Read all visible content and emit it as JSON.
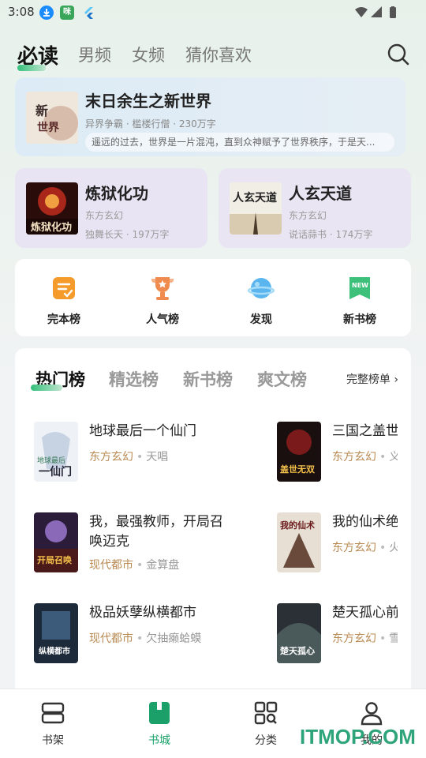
{
  "status_bar": {
    "time": "3:08",
    "app_badge": "咪"
  },
  "top_tabs": [
    {
      "label": "必读",
      "active": true
    },
    {
      "label": "男频",
      "active": false
    },
    {
      "label": "女频",
      "active": false
    },
    {
      "label": "猜你喜欢",
      "active": false
    }
  ],
  "featured": {
    "title": "末日余生之新世界",
    "meta": "异界争霸 · 槛楼行僧 · 230万字",
    "desc": "遥远的过去，世界是一片混沌，直到众神赋予了世界秩序，于是天...",
    "cover_text": "新世界"
  },
  "mini_cards": [
    {
      "title": "炼狱化功",
      "category": "东方玄幻",
      "meta": "独舞长天 · 197万字",
      "cover_text": "炼狱化功"
    },
    {
      "title": "人玄天道",
      "category": "东方玄幻",
      "meta": "说话蒜书 · 174万字",
      "cover_text": "人玄天道"
    }
  ],
  "shortcuts": [
    {
      "label": "完本榜",
      "icon": "checklist-icon",
      "color": "#f59b2b"
    },
    {
      "label": "人气榜",
      "icon": "trophy-icon",
      "color": "#f08b4f"
    },
    {
      "label": "发现",
      "icon": "planet-icon",
      "color": "#5bb6f0"
    },
    {
      "label": "新书榜",
      "icon": "new-badge-icon",
      "color": "#3dc07a"
    }
  ],
  "rank": {
    "tabs": [
      {
        "label": "热门榜",
        "active": true
      },
      {
        "label": "精选榜",
        "active": false
      },
      {
        "label": "新书榜",
        "active": false
      },
      {
        "label": "爽文榜",
        "active": false
      }
    ],
    "full_list_label": "完整榜单",
    "books": [
      {
        "title": "地球最后一个仙门",
        "category": "东方玄幻",
        "author": "天唱"
      },
      {
        "title": "三国之盖世",
        "category": "东方玄幻",
        "author": "义"
      },
      {
        "title": "我，最强教师，开局召唤迈克",
        "category": "现代都市",
        "author": "金算盘"
      },
      {
        "title": "我的仙术绝",
        "category": "东方玄幻",
        "author": "火"
      },
      {
        "title": "极品妖孽纵横都市",
        "category": "现代都市",
        "author": "欠抽癞蛤蟆"
      },
      {
        "title": "楚天孤心前",
        "category": "东方玄幻",
        "author": "雪"
      }
    ]
  },
  "bottom_nav": [
    {
      "label": "书架",
      "icon": "bookshelf-icon",
      "active": false
    },
    {
      "label": "书城",
      "icon": "bookstore-icon",
      "active": true
    },
    {
      "label": "分类",
      "icon": "category-icon",
      "active": false
    },
    {
      "label": "我的",
      "icon": "profile-icon",
      "active": false
    }
  ],
  "watermark": "ITMOP.COM",
  "colors": {
    "accent": "#1aa068",
    "category": "#b98a52"
  }
}
